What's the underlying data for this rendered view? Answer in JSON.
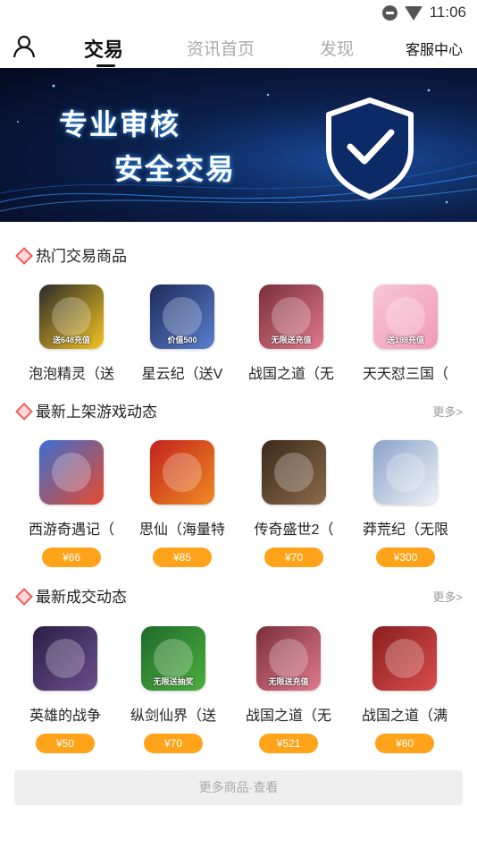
{
  "status_bar": {
    "time": "11:06",
    "icons": [
      "do-not-disturb-icon",
      "wifi-icon"
    ]
  },
  "nav": {
    "tabs": [
      {
        "label": "交易",
        "active": true
      },
      {
        "label": "资讯首页",
        "active": false
      },
      {
        "label": "发现",
        "active": false
      }
    ],
    "service_label": "客服中心",
    "icons": [
      "user-icon"
    ]
  },
  "banner": {
    "line1": "专业审核",
    "line2": "安全交易",
    "icon": "shield-check-icon"
  },
  "hot": {
    "title": "热门交易商品",
    "items": [
      {
        "name": "泡泡精灵（送",
        "icon_text": "送648充值",
        "color": "#f3c521"
      },
      {
        "name": "星云纪（送V",
        "icon_text": "价值500",
        "color": "#5b7fcf"
      },
      {
        "name": "战国之道（无",
        "icon_text": "无限送充值",
        "color": "#e07a8c"
      },
      {
        "name": "天天怼三国（",
        "icon_text": "送198充值",
        "color": "#f29ab8"
      }
    ]
  },
  "latest_games": {
    "title": "最新上架游戏动态",
    "more": "更多>",
    "items": [
      {
        "name": "西游奇遇记（",
        "price": "¥66",
        "icon_text": "",
        "color": "#e64a2e"
      },
      {
        "name": "思仙（海量特",
        "price": "¥85",
        "icon_text": "",
        "color": "#f08a24"
      },
      {
        "name": "传奇盛世2（",
        "price": "¥70",
        "icon_text": "",
        "color": "#8a6a4a"
      },
      {
        "name": "莽荒纪（无限",
        "price": "¥300",
        "icon_text": "",
        "color": "#c9d6e8"
      }
    ]
  },
  "latest_deals": {
    "title": "最新成交动态",
    "more": "更多>",
    "items": [
      {
        "name": "英雄的战争",
        "price": "¥50",
        "icon_text": "",
        "color": "#6a4e8c"
      },
      {
        "name": "纵剑仙界（送",
        "price": "¥70",
        "icon_text": "无限送抽奖",
        "color": "#4cae3e"
      },
      {
        "name": "战国之道（无",
        "price": "¥521",
        "icon_text": "无限送充值",
        "color": "#e07a8c"
      },
      {
        "name": "战国之道（满",
        "price": "¥60",
        "icon_text": "",
        "color": "#d94c4c"
      }
    ]
  },
  "footer": {
    "more_products": "更多商品·查看"
  }
}
